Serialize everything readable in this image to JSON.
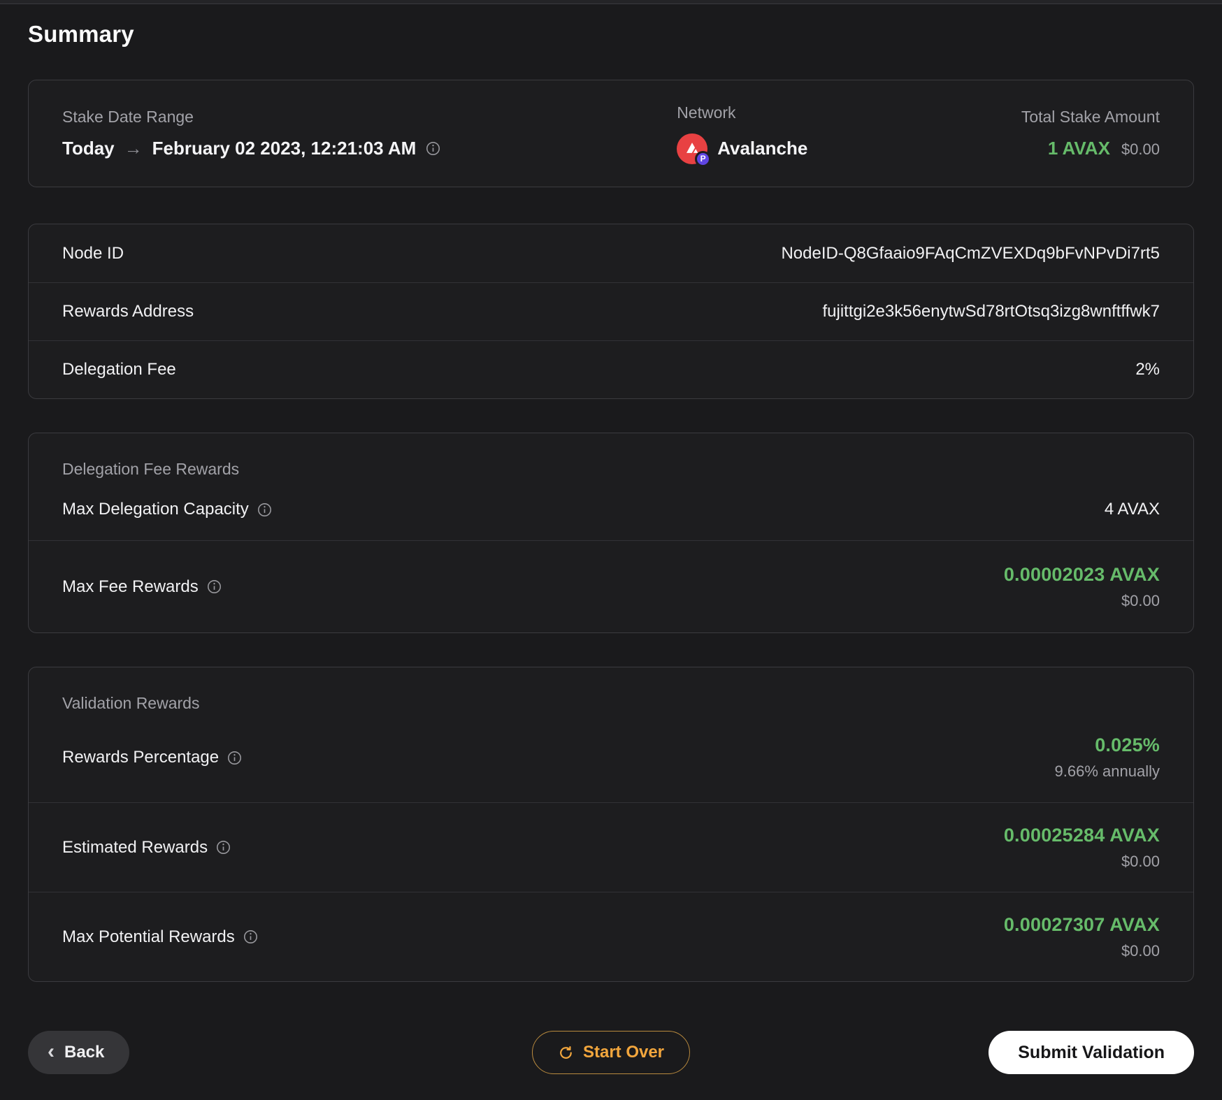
{
  "page": {
    "title": "Summary"
  },
  "colors": {
    "accent_green": "#66bb6a",
    "accent_orange": "#f2a63d",
    "avalanche_red": "#e84142",
    "p_chain_badge_purple": "#5f45e2"
  },
  "overview": {
    "stake_date_range": {
      "label": "Stake Date Range",
      "start": "Today",
      "arrow": "→",
      "end": "February 02 2023, 12:21:03 AM"
    },
    "network": {
      "label": "Network",
      "value": "Avalanche",
      "badge_letter": "P"
    },
    "total_stake": {
      "label": "Total Stake Amount",
      "amount": "1 AVAX",
      "usd": "$0.00"
    }
  },
  "details": {
    "rows": [
      {
        "label": "Node ID",
        "value": "NodeID-Q8Gfaaio9FAqCmZVEXDq9bFvNPvDi7rt5"
      },
      {
        "label": "Rewards Address",
        "value": "fujittgi2e3k56enytwSd78rtOtsq3izg8wnftffwk7"
      },
      {
        "label": "Delegation Fee",
        "value": "2%"
      }
    ]
  },
  "delegation_fee_rewards": {
    "section_label": "Delegation Fee Rewards",
    "max_delegation_capacity": {
      "label": "Max Delegation Capacity",
      "value": "4 AVAX"
    },
    "max_fee_rewards": {
      "label": "Max Fee Rewards",
      "value": "0.00002023 AVAX",
      "usd": "$0.00"
    }
  },
  "validation_rewards": {
    "section_label": "Validation Rewards",
    "rows": [
      {
        "label": "Rewards Percentage",
        "value": "0.025%",
        "sub": "9.66% annually"
      },
      {
        "label": "Estimated Rewards",
        "value": "0.00025284 AVAX",
        "sub": "$0.00"
      },
      {
        "label": "Max Potential Rewards",
        "value": "0.00027307 AVAX",
        "sub": "$0.00"
      }
    ]
  },
  "footer": {
    "back_label": "Back",
    "start_over_label": "Start Over",
    "submit_label": "Submit Validation"
  }
}
